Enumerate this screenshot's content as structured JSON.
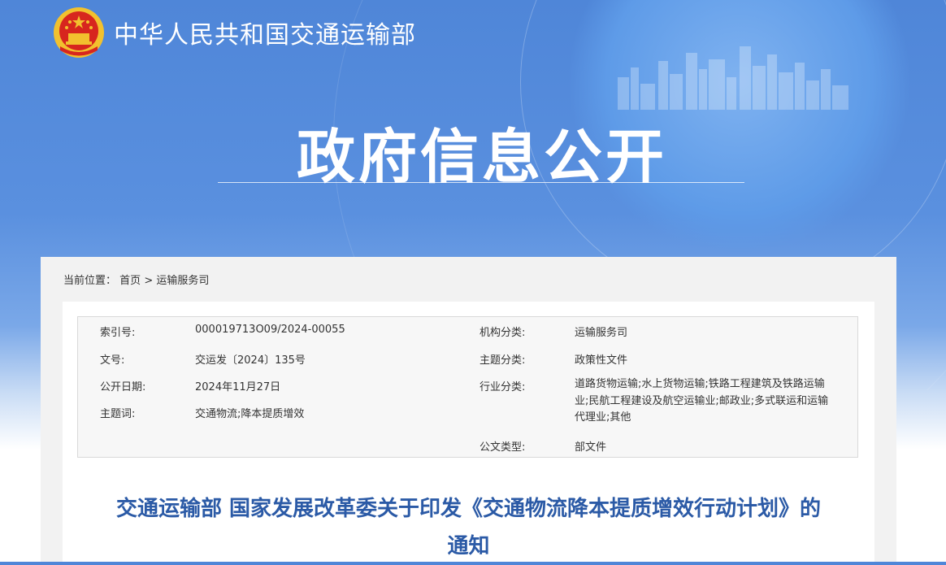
{
  "header": {
    "site_title": "中华人民共和国交通运输部",
    "section_title": "政府信息公开"
  },
  "breadcrumb": {
    "label": "当前位置：",
    "home": "首页",
    "separator": ">",
    "current": "运输服务司"
  },
  "meta": {
    "index_label": "索引号:",
    "index_value": "000019713O09/2024-00055",
    "docno_label": "文号:",
    "docno_value": "交运发〔2024〕135号",
    "date_label": "公开日期:",
    "date_value": "2024年11月27日",
    "keyword_label": "主题词:",
    "keyword_value": "交通物流;降本提质增效",
    "org_label": "机构分类:",
    "org_value": "运输服务司",
    "topic_label": "主题分类:",
    "topic_value": "政策性文件",
    "industry_label": "行业分类:",
    "industry_value": "道路货物运输;水上货物运输;铁路工程建筑及铁路运输业;民航工程建设及航空运输业;邮政业;多式联运和运输代理业;其他",
    "doctype_label": "公文类型:",
    "doctype_value": "部文件"
  },
  "document": {
    "title_line1": "交通运输部 国家发展改革委关于印发《交通物流降本提质增效行动计划》的",
    "title_line2": "通知"
  },
  "colors": {
    "banner_blue": "#4f86d8",
    "title_blue": "#2b5aa6",
    "emblem_red": "#d7261e",
    "emblem_gold": "#f2c12e"
  }
}
